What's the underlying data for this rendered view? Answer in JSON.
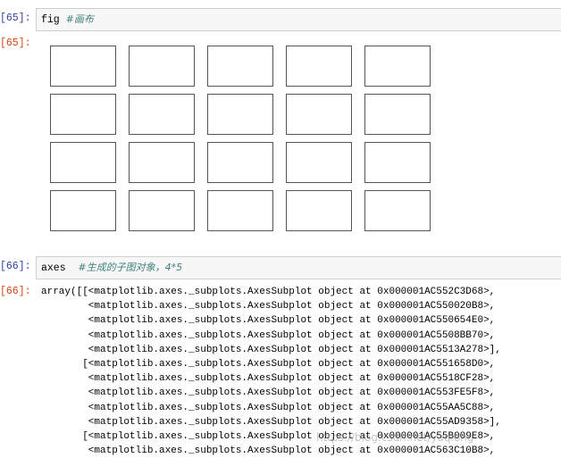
{
  "cells": [
    {
      "in_prompt": "[65]:",
      "code": "fig ",
      "comment": "#画布",
      "out_prompt": "[65]:"
    },
    {
      "in_prompt": "[66]:",
      "code": "axes  ",
      "comment": "#生成的子图对象，4*5",
      "out_prompt": "[66]:"
    }
  ],
  "figure": {
    "rows": 4,
    "cols": 5
  },
  "output_lines": [
    "array([[<matplotlib.axes._subplots.AxesSubplot object at 0x000001AC552C3D68>,",
    "        <matplotlib.axes._subplots.AxesSubplot object at 0x000001AC550020B8>,",
    "        <matplotlib.axes._subplots.AxesSubplot object at 0x000001AC550654E0>,",
    "        <matplotlib.axes._subplots.AxesSubplot object at 0x000001AC5508BB70>,",
    "        <matplotlib.axes._subplots.AxesSubplot object at 0x000001AC5513A278>],",
    "       [<matplotlib.axes._subplots.AxesSubplot object at 0x000001AC551658D0>,",
    "        <matplotlib.axes._subplots.AxesSubplot object at 0x000001AC5518CF28>,",
    "        <matplotlib.axes._subplots.AxesSubplot object at 0x000001AC553FE5F8>,",
    "        <matplotlib.axes._subplots.AxesSubplot object at 0x000001AC55AA5C88>,",
    "        <matplotlib.axes._subplots.AxesSubplot object at 0x000001AC55AD9358>],",
    "       [<matplotlib.axes._subplots.AxesSubplot object at 0x000001AC55B009E8>,",
    "        <matplotlib.axes._subplots.AxesSubplot object at 0x000001AC563C10B8>,"
  ],
  "watermark": "https://blog.csdn.net/yaqiong"
}
